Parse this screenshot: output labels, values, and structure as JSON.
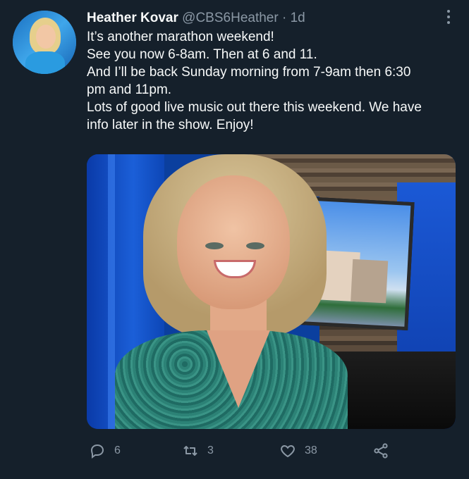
{
  "tweet": {
    "author_name": "Heather Kovar",
    "author_handle": "@CBS6Heather",
    "separator": "·",
    "time": "1d",
    "text_lines": [
      "It’s another marathon weekend!",
      "See you now 6-8am. Then at 6 and 11.",
      "And I’ll be back Sunday morning from 7-9am then 6:30",
      "pm and 11pm.",
      "Lots of good live music out there this weekend. We have",
      "info later in the show. Enjoy!"
    ]
  },
  "actions": {
    "reply_count": "6",
    "retweet_count": "3",
    "like_count": "38"
  },
  "icons": {
    "more": "more-vertical-icon",
    "reply": "reply-icon",
    "retweet": "retweet-icon",
    "like": "heart-icon",
    "share": "share-icon"
  },
  "colors": {
    "background": "#15202b",
    "primary_text": "#f7f9f9",
    "secondary_text": "#8b98a5"
  }
}
